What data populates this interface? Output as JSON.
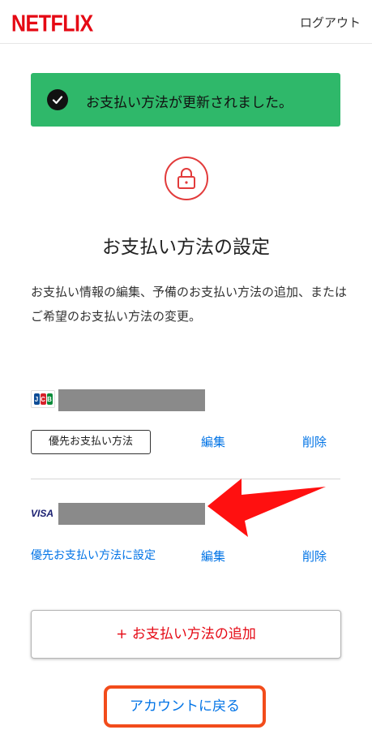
{
  "header": {
    "logo": "NETFLIX",
    "logout_label": "ログアウト"
  },
  "banner": {
    "message": "お支払い方法が更新されました。",
    "icon": "check-circle-icon",
    "color": "#2fb86a"
  },
  "page": {
    "title": "お支払い方法の設定",
    "description": "お支払い情報の編集、予備のお支払い方法の追加、またはご希望のお支払い方法の変更。"
  },
  "cards": [
    {
      "brand": "JCB",
      "number_masked": true,
      "preferred_badge": "優先お支払い方法",
      "edit_label": "編集",
      "delete_label": "削除"
    },
    {
      "brand": "VISA",
      "number_masked": true,
      "set_preferred_label": "優先お支払い方法に設定",
      "edit_label": "編集",
      "delete_label": "削除"
    }
  ],
  "actions": {
    "add_payment_label": "+ お支払い方法の追加",
    "back_label": "アカウントに戻る"
  },
  "colors": {
    "brand_red": "#e50914",
    "link_blue": "#0073e6",
    "highlight_orange": "#f24c1b",
    "annotation_red": "#ff1010"
  }
}
